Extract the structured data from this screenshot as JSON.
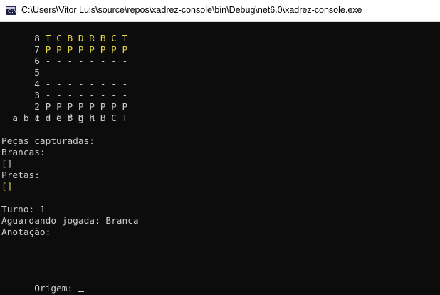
{
  "window": {
    "title": "C:\\Users\\Vitor Luis\\source\\repos\\xadrez-console\\bin\\Debug\\net6.0\\xadrez-console.exe",
    "icon": "console-app-icon",
    "icon_glyph": "C:\\"
  },
  "colors": {
    "console_bg": "#0c0c0c",
    "text_default": "#cccccc",
    "text_black_pieces": "#e5d74a"
  },
  "board": {
    "rows": [
      {
        "rank": "8",
        "squares": "T C B D R B C T",
        "side": "black"
      },
      {
        "rank": "7",
        "squares": "P P P P P P P P",
        "side": "black"
      },
      {
        "rank": "6",
        "squares": "- - - - - - - -",
        "side": "empty"
      },
      {
        "rank": "5",
        "squares": "- - - - - - - -",
        "side": "empty"
      },
      {
        "rank": "4",
        "squares": "- - - - - - - -",
        "side": "empty"
      },
      {
        "rank": "3",
        "squares": "- - - - - - - -",
        "side": "empty"
      },
      {
        "rank": "2",
        "squares": "P P P P P P P P",
        "side": "white"
      },
      {
        "rank": "1",
        "squares": "T C B D R B C T",
        "side": "white"
      }
    ],
    "files": "  a b c d e f g h"
  },
  "captured": {
    "heading": "Peças capturadas:",
    "white_label": "Brancas:",
    "white_list": "[]",
    "black_label": "Pretas:",
    "black_list": "[]"
  },
  "status": {
    "turn": "Turno: 1",
    "waiting": "Aguardando jogada: Branca",
    "notation": "Anotação:"
  },
  "prompt": {
    "origin": "Origem: "
  }
}
